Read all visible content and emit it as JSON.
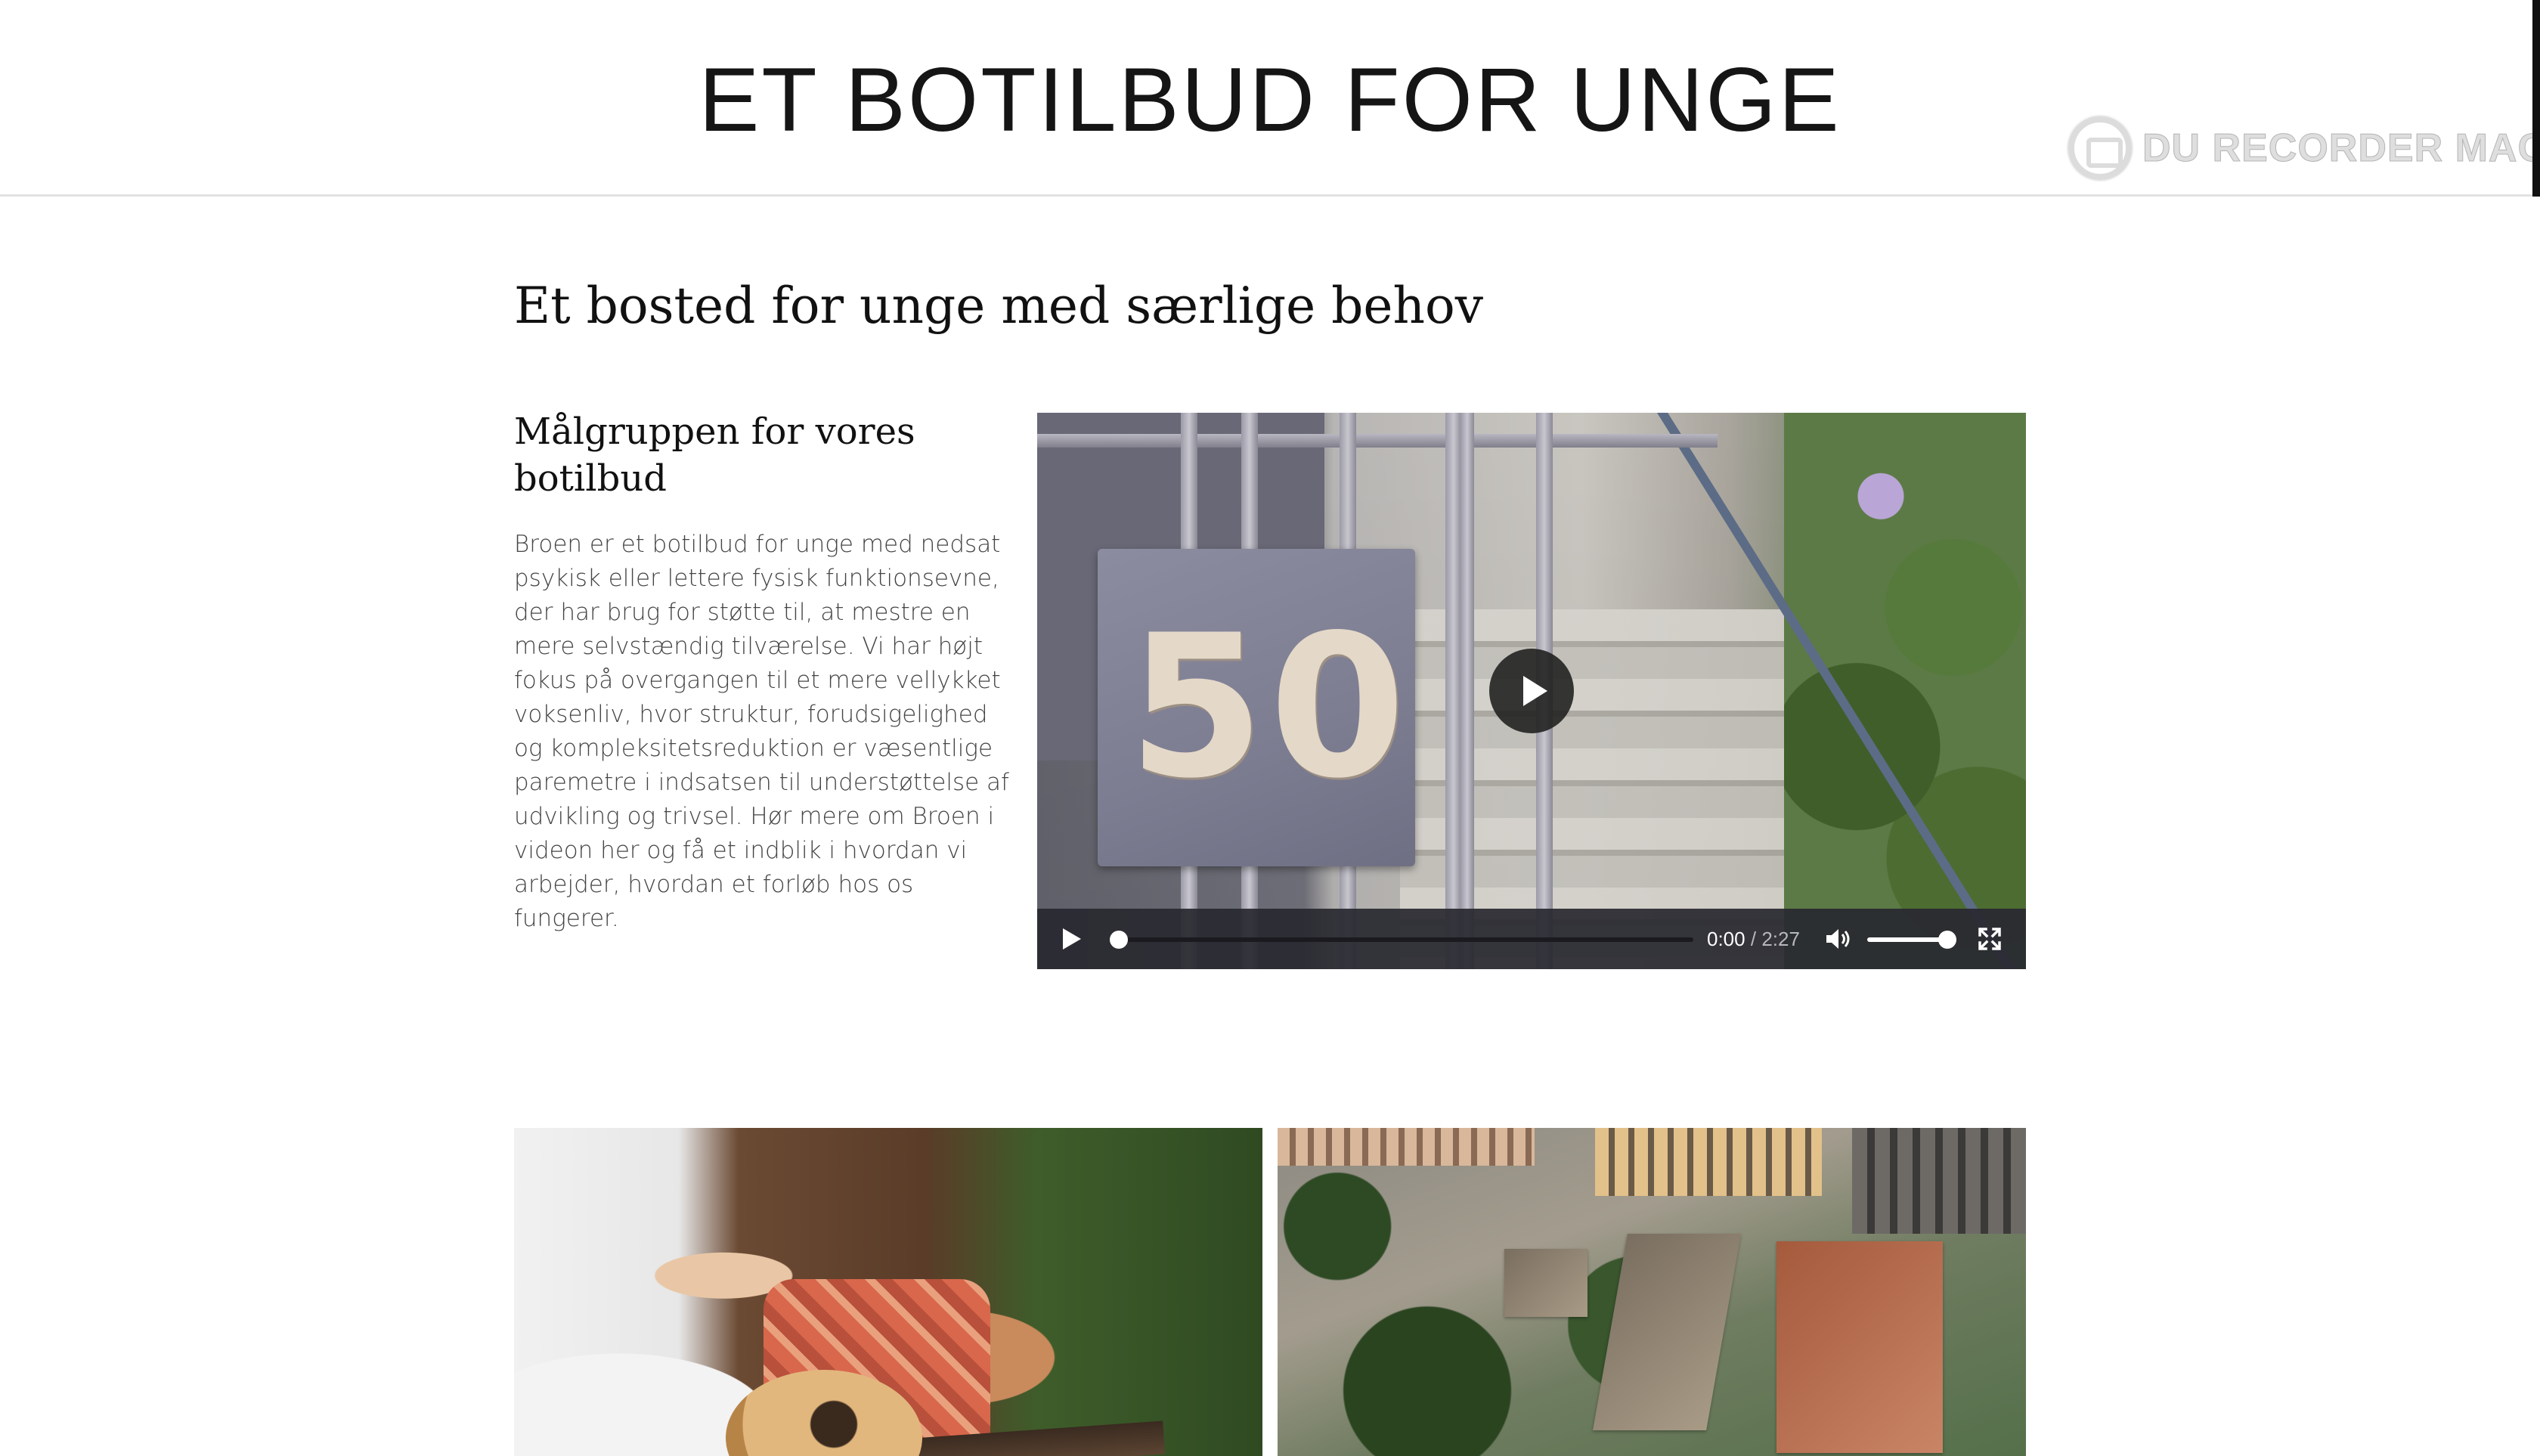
{
  "header": {
    "title": "ET BOTILBUD FOR UNGE",
    "watermark": "DU RECORDER MAC",
    "watermark_icon": "camera-icon"
  },
  "main": {
    "heading": "Et bosted for unge med særlige behov",
    "section": {
      "heading": "Målgruppen for vores botilbud",
      "body": "Broen er et botilbud for unge med nedsat psykisk eller lettere fysisk funktionsevne, der har brug for støtte til, at mestre en mere selvstændig tilværelse. Vi har højt fokus på overgangen til et mere vellykket voksenliv, hvor struktur, forudsigelighed og kompleksitetsreduktion er væsentlige paremetre i indsatsen til understøttelse af udvikling og trivsel. Hør mere om Broen i videon her og få et indblik i hvordan vi arbejder, hvordan et forløb hos os fungerer."
    },
    "video": {
      "poster_sign_number": "50",
      "current_time": "0:00",
      "separator": "/",
      "duration": "2:27",
      "progress_fraction": 0.0,
      "volume_fraction": 1.0,
      "icons": {
        "big_play": "play-icon",
        "play": "play-icon",
        "volume": "volume-icon",
        "fullscreen": "fullscreen-icon"
      }
    },
    "photos": [
      {
        "subject": "two men playing guitar outdoors"
      },
      {
        "subject": "aerial view of buildings and trees"
      }
    ]
  },
  "colors": {
    "text": "#111111",
    "body_text": "#444444",
    "header_border": "#e2e2e2",
    "controls_bg": "#28282f"
  }
}
